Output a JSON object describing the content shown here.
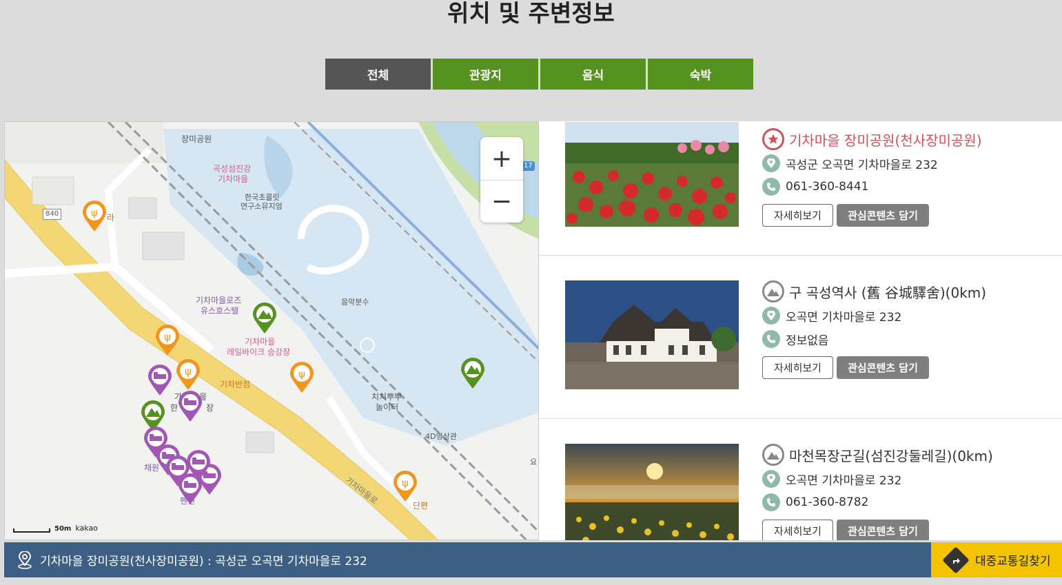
{
  "page": {
    "title": "위치 및 주변정보"
  },
  "tabs": [
    {
      "label": "전체",
      "active": true
    },
    {
      "label": "관광지",
      "active": false
    },
    {
      "label": "음식",
      "active": false
    },
    {
      "label": "숙박",
      "active": false
    }
  ],
  "map": {
    "zoom_in": "+",
    "zoom_out": "−",
    "scale_label": "50m",
    "provider": "kakao",
    "road_badge": "840",
    "road_badge2": "17",
    "labels": {
      "rose_park": "장미공원",
      "train_village_1": "곡성섬진강",
      "train_village_2": "기차마을",
      "chocolate_1": "한국초콜릿",
      "chocolate_2": "연구소뮤지엄",
      "hostel_1": "기차마을로즈",
      "hostel_2": "유스호스텔",
      "music_fountain": "음악분수",
      "railbike_1": "기차마을",
      "railbike_2": "레일바이크 승강장",
      "train_restaurant": "기차반점",
      "playground_1": "치치뿌뿌",
      "playground_2": "놀이터",
      "theater": "4D영상관",
      "road_name": "기차마을로",
      "danpyeon": "단편",
      "chaewon": "채원",
      "pension": "펜션",
      "misc_ra": "라",
      "misc_han": "한",
      "misc_ga": "가",
      "misc_eul": "을",
      "misc_jang": "장",
      "misc_yo": "요"
    },
    "colors": {
      "tour": "#55921f",
      "food": "#f0961e",
      "stay": "#a058b4"
    }
  },
  "places": [
    {
      "title": "기차마을 장미공원(천사장미공원)",
      "category_icon": "star-icon",
      "address": "곡성군 오곡면 기차마을로 232",
      "phone": "061-360-8441",
      "detail_button": "자세히보기",
      "save_button": "관심콘텐츠 담기"
    },
    {
      "title": "구 곡성역사 (舊 谷城驛舍)(0km)",
      "category_icon": "mountain-icon",
      "address": "오곡면 기차마을로 232",
      "phone": "정보없음",
      "detail_button": "자세히보기",
      "save_button": "관심콘텐츠 담기"
    },
    {
      "title": "마천목장군길(섬진강둘레길)(0km)",
      "category_icon": "mountain-icon",
      "address": "오곡면 기차마을로 232",
      "phone": "061-360-8782",
      "detail_button": "자세히보기",
      "save_button": "관심콘텐츠 담기"
    }
  ],
  "footer": {
    "location_text": "기차마을 장미공원(천사장미공원) : 곡성군 오곡면 기차마을로 232",
    "route_button": "대중교통길찾기"
  }
}
